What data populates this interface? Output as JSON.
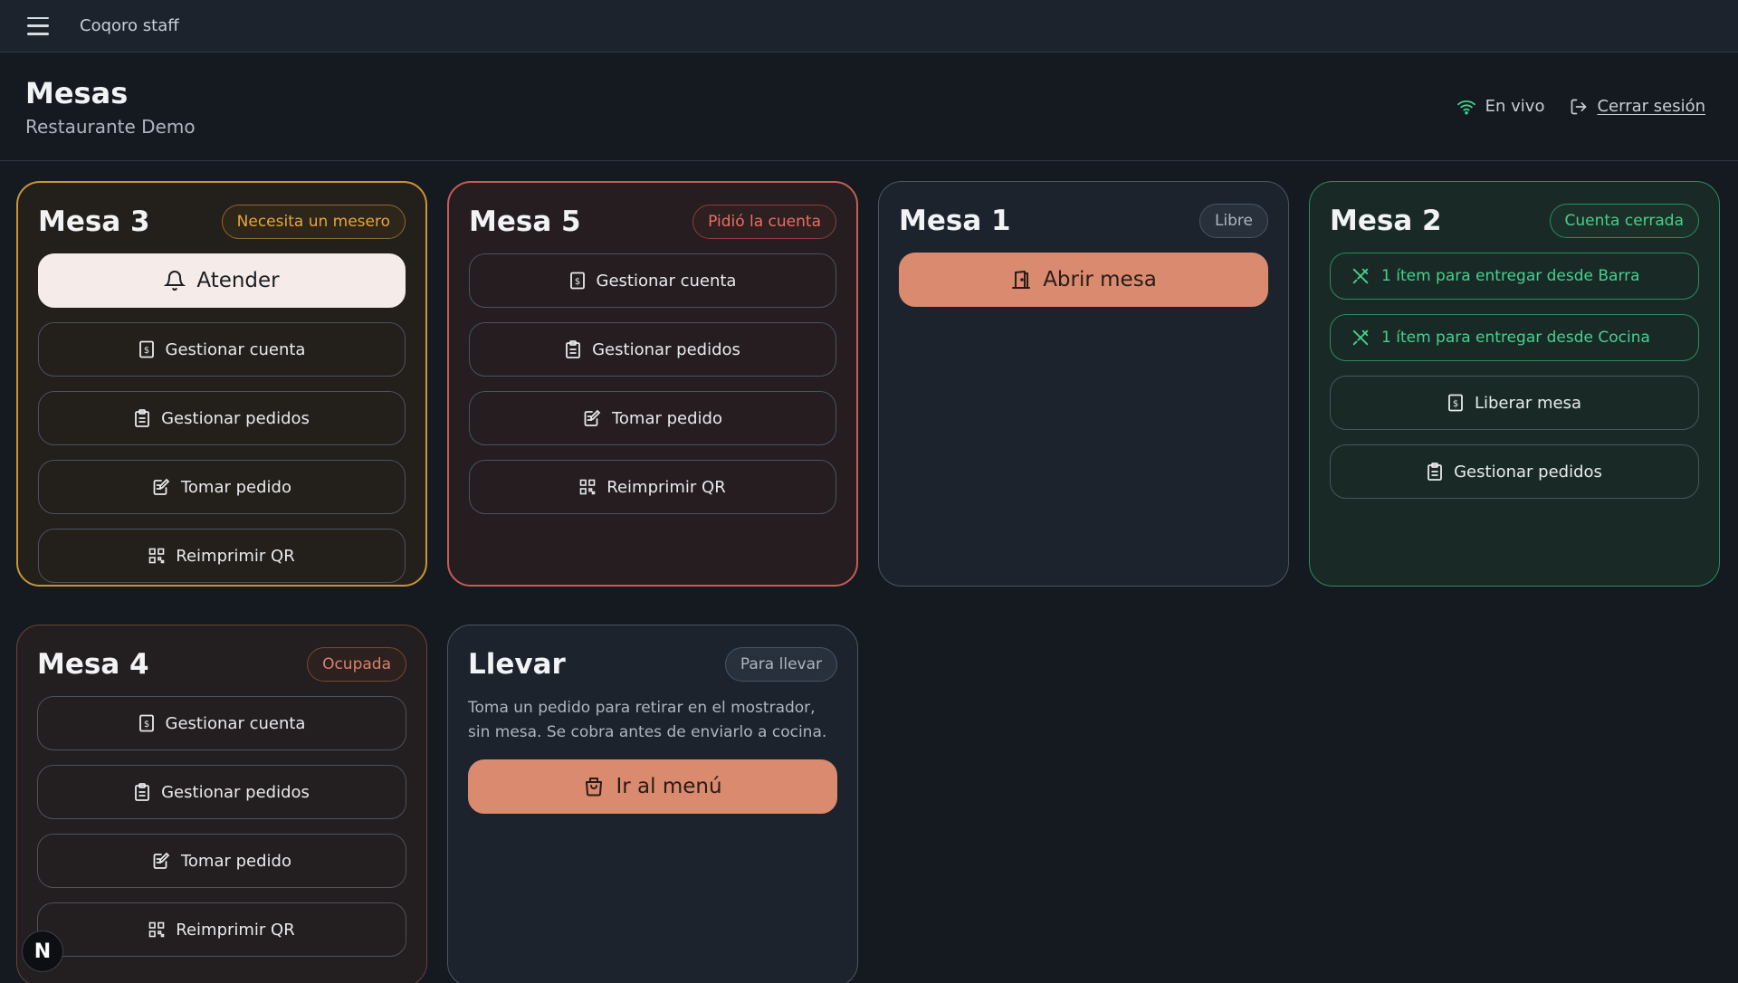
{
  "app": {
    "brand": "Coqoro staff"
  },
  "header": {
    "title": "Mesas",
    "subtitle": "Restaurante Demo",
    "live_label": "En vivo",
    "logout_label": "Cerrar sesión"
  },
  "tables": [
    {
      "name": "Mesa 3",
      "status": "Necesita un mesero",
      "actions": [
        "Atender",
        "Gestionar cuenta",
        "Gestionar pedidos",
        "Tomar pedido",
        "Reimprimir QR"
      ]
    },
    {
      "name": "Mesa 5",
      "status": "Pidió la cuenta",
      "actions": [
        "Gestionar cuenta",
        "Gestionar pedidos",
        "Tomar pedido",
        "Reimprimir QR"
      ]
    },
    {
      "name": "Mesa 1",
      "status": "Libre",
      "actions": [
        "Abrir mesa"
      ]
    },
    {
      "name": "Mesa 2",
      "status": "Cuenta cerrada",
      "deliveries": [
        "1 ítem para entregar desde Barra",
        "1 ítem para entregar desde Cocina"
      ],
      "actions": [
        "Liberar mesa",
        "Gestionar pedidos"
      ]
    },
    {
      "name": "Mesa 4",
      "status": "Ocupada",
      "actions": [
        "Gestionar cuenta",
        "Gestionar pedidos",
        "Tomar pedido",
        "Reimprimir QR"
      ]
    }
  ],
  "takeaway": {
    "name": "Llevar",
    "status": "Para llevar",
    "description": "Toma un pedido para retirar en el mostrador, sin mesa. Se cobra antes de enviarlo a cocina.",
    "action": "Ir al menú"
  },
  "devtools_badge": "N",
  "colors": {
    "needs_waiter": "#d9a23a",
    "asked_bill": "#d9665a",
    "free": "#4a5565",
    "closed": "#2e9a66",
    "occupied": "#b0644a",
    "accent": "#d98a6f"
  }
}
